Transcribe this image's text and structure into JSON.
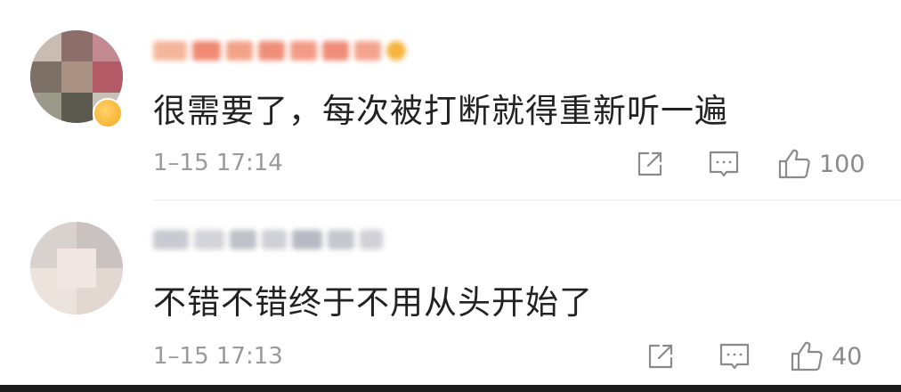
{
  "comments": [
    {
      "text": "很需要了，每次被打断就得重新听一遍",
      "time": "1–15 17:14",
      "likes": "100"
    },
    {
      "text": "不错不错终于不用从头开始了",
      "time": "1–15 17:13",
      "likes": "40"
    }
  ],
  "icons": {
    "share": "share-icon",
    "reply": "comment-icon",
    "like": "thumbs-up-icon"
  },
  "colors": {
    "text": "#222222",
    "meta": "#9a9a9a",
    "icon": "#8a8a8a"
  }
}
